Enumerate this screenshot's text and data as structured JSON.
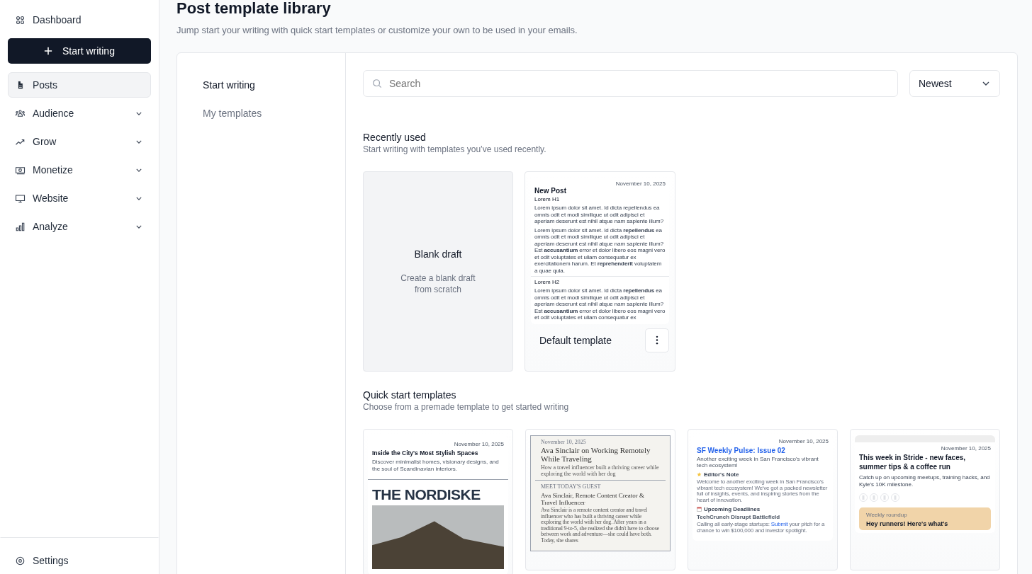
{
  "sidebar": {
    "dashboard": "Dashboard",
    "start_button": "Start writing",
    "items": [
      {
        "label": "Posts",
        "kind": "link",
        "selected": true
      },
      {
        "label": "Audience",
        "kind": "menu",
        "selected": false,
        "expanded": false
      },
      {
        "label": "Grow",
        "kind": "menu",
        "selected": false,
        "expanded": false
      },
      {
        "label": "Monetize",
        "kind": "menu",
        "selected": false,
        "expanded": false
      },
      {
        "label": "Website",
        "kind": "menu",
        "selected": false,
        "expanded": false
      },
      {
        "label": "Analyze",
        "kind": "menu",
        "selected": false,
        "expanded": false
      }
    ],
    "settings": "Settings"
  },
  "header": {
    "title": "Post template library",
    "subtitle": "Jump start your writing with quick start templates or customize your own to be used in your emails."
  },
  "tabs": [
    {
      "label": "Start writing",
      "selected": true
    },
    {
      "label": "My templates",
      "selected": false
    }
  ],
  "search": {
    "placeholder": "Search"
  },
  "sort": {
    "value": "Newest"
  },
  "recent": {
    "title": "Recently used",
    "description": "Start writing with templates you’ve used recently.",
    "blank": {
      "title": "Blank draft",
      "description": "Create a blank draft from scratch"
    },
    "template": {
      "name": "Default template",
      "preview": [
        {
          "kind": "date",
          "text": "November 10, 2025"
        },
        {
          "kind": "title",
          "text": "New Post"
        },
        {
          "kind": "heading",
          "text": "Lorem H1"
        },
        {
          "kind": "paragraph",
          "text": "Lorem ipsum dolor sit amet. Id dicta repellendus ea omnis odit et modi similique ut odit adipisci et aperiam deserunt est nihil atque nam sapiente illum?"
        },
        {
          "kind": "paragraph",
          "text": "Lorem ipsum dolor sit amet. Id dicta **repellendus** ea omnis odit et modi similique ut odit adipisci et aperiam deserunt est nihil atque nam sapiente illum? Est **accusantium** error et dolor libero eos magni vero et odit voluptates et ullam consequatur ex exercitationem harum. Et **reprehenderit** voluptatem a quae quia."
        },
        {
          "kind": "rule"
        },
        {
          "kind": "subheading",
          "text": "Lorem H2"
        },
        {
          "kind": "paragraph",
          "text": "Lorem ipsum dolor sit amet. Id dicta **repellendus** ea omnis odit et modi similique ut odit adipisci et aperiam deserunt est nihil atque nam sapiente illum? Est **accusantium** error et dolor libero eos magni vero et odit voluptates et ullam consequatur ex"
        }
      ]
    }
  },
  "quick": {
    "title": "Quick start templates",
    "description": "Choose from a premade template to get started writing",
    "templates": [
      {
        "kind": "modern",
        "preview": [
          {
            "kind": "date",
            "text": "November 10, 2025"
          },
          {
            "kind": "title",
            "text": "Inside the City's Most Stylish Spaces"
          },
          {
            "kind": "subtitle",
            "text": "Discover minimalist homes, visionary designs, and the soul of Scandinavian interiors."
          },
          {
            "kind": "rule"
          },
          {
            "kind": "banner",
            "text": "THE NORDISKE"
          },
          {
            "kind": "photo"
          }
        ]
      },
      {
        "kind": "serif",
        "preview": [
          {
            "kind": "date",
            "text": "November 10, 2025"
          },
          {
            "kind": "title",
            "text": "Ava Sinclair on Working Remotely While Traveling"
          },
          {
            "kind": "subtitle",
            "text": "How a travel influencer built a thriving career while exploring the world with her dog"
          },
          {
            "kind": "rule"
          },
          {
            "kind": "label",
            "text": "MEET TODAY'S GUEST"
          },
          {
            "kind": "heading",
            "text": "Ava Sinclair, Remote Content Creator & Travel Influencer"
          },
          {
            "kind": "paragraph",
            "text": "Ava Sinclair is a remote content creator and travel influencer who has built a thriving career while exploring the world with her dog. After years in a traditional 9-to-5, she realized she didn't have to choose between work and adventure—she could have both. Today, she shares"
          }
        ]
      },
      {
        "kind": "tech",
        "preview": [
          {
            "kind": "date",
            "text": "November 10, 2025"
          },
          {
            "kind": "title",
            "text": "SF Weekly Pulse: Issue 02"
          },
          {
            "kind": "subtitle",
            "text": "Another exciting week in San Francisco's vibrant tech ecosystem!"
          },
          {
            "kind": "note_heading",
            "text": "Editor's Note"
          },
          {
            "kind": "paragraph",
            "text": "Welcome to another exciting week in San Francisco's vibrant tech ecosystem! We've got a packed newsletter full of insights, events, and inspiring stories from the heart of innovation."
          },
          {
            "kind": "calendar_heading",
            "text": "Upcoming Deadlines"
          },
          {
            "kind": "subheading",
            "text": "TechCrunch Disrupt Battlefield"
          },
          {
            "kind": "link_paragraph",
            "before": "Calling all early-stage startups: ",
            "link": "Submit",
            "after": " your pitch for a chance to win $100,000 and investor spotlight."
          }
        ]
      },
      {
        "kind": "sport",
        "preview": [
          {
            "kind": "date",
            "text": "November 10, 2025"
          },
          {
            "kind": "title",
            "text": "This week in Stride - new faces, summer tips & a coffee run"
          },
          {
            "kind": "subtitle",
            "text": "Catch up on upcoming meetups, training hacks, and Kyle's 10K milestone."
          },
          {
            "kind": "social"
          },
          {
            "kind": "callout",
            "label": "Weekly roundup",
            "text": "Hey runners! Here's what's"
          }
        ]
      }
    ]
  }
}
